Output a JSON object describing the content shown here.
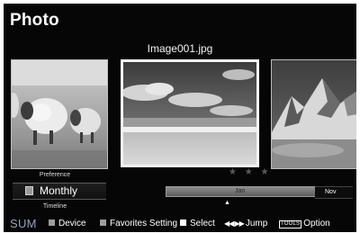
{
  "header": {
    "title": "Photo"
  },
  "viewer": {
    "current_file": "Image001.jpg",
    "rating_stars": "★ ★ ★"
  },
  "sort": {
    "preference_label": "Preference",
    "current_value": "Monthly",
    "timeline_label": "Timeline"
  },
  "timeline": {
    "current_month": "Jan",
    "next_month": "Nov",
    "marker": "▲"
  },
  "footer": {
    "brand": "SUM",
    "device_label": "Device",
    "favorites_label": "Favorites Setting",
    "select_label": "Select",
    "jump_arrows": "◀◀ ▶▶",
    "jump_label": "Jump",
    "tools_badge": "TOOLS",
    "option_label": "Option"
  },
  "colors": {
    "background": "#060606",
    "brand_text": "#8fa2c2",
    "device_key": "#9c9c9c",
    "favorites_key": "#9c9c9c",
    "select_key": "#ffffff"
  },
  "icons": {
    "sort": "list-icon",
    "stars": "star-rating-icon",
    "marker": "triangle-up-icon"
  }
}
